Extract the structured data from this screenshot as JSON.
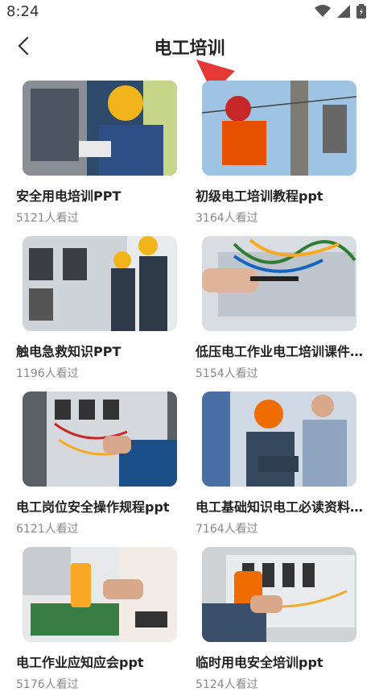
{
  "status": {
    "time": "8:24"
  },
  "header": {
    "title": "电工培训"
  },
  "courses": [
    {
      "title": "安全用电培训PPT",
      "views": "5121人看过"
    },
    {
      "title": "初级电工培训教程ppt",
      "views": "3164人看过"
    },
    {
      "title": "触电急救知识PPT",
      "views": "1196人看过"
    },
    {
      "title": "低压电工作业电工培训课件…",
      "views": "5154人看过"
    },
    {
      "title": "电工岗位安全操作规程ppt",
      "views": "6121人看过"
    },
    {
      "title": "电工基础知识电工必读资料…",
      "views": "7164人看过"
    },
    {
      "title": "电工作业应知应会ppt",
      "views": "5176人看过"
    },
    {
      "title": "临时用电安全培训ppt",
      "views": "5124人看过"
    }
  ],
  "colors": {
    "accent_arrow": "#e53935",
    "title": "#222222",
    "meta": "#888888"
  }
}
